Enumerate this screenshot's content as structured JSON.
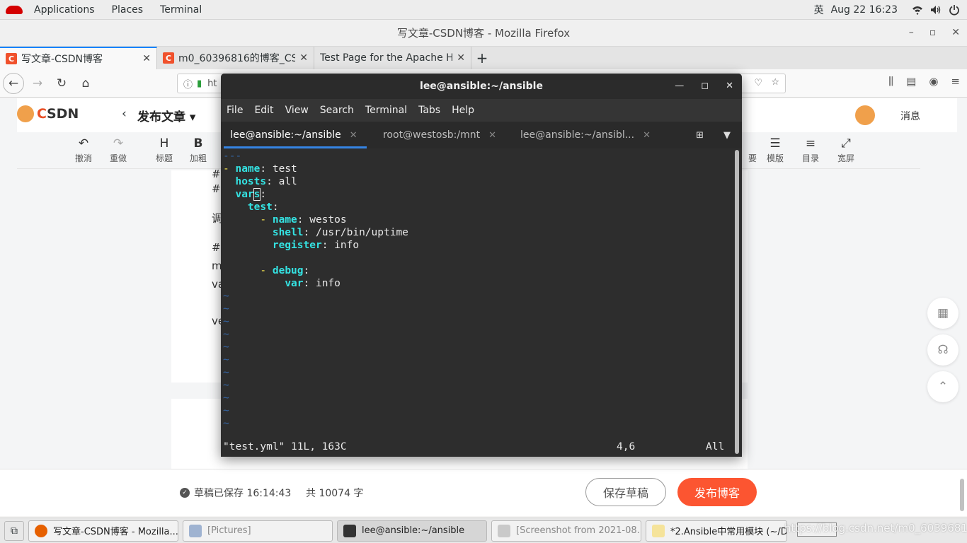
{
  "topbar": {
    "apps_label": "Applications",
    "places_label": "Places",
    "terminal_label": "Terminal",
    "input_method": "英",
    "clock": "Aug 22  16:23"
  },
  "firefox": {
    "window_title": "写文章-CSDN博客 - Mozilla Firefox",
    "tabs": [
      {
        "label": "写文章-CSDN博客",
        "active": true
      },
      {
        "label": "m0_60396816的博客_CS",
        "active": false
      },
      {
        "label": "Test Page for the Apache HT",
        "active": false
      }
    ],
    "url_fragment": "ht"
  },
  "csdn": {
    "logo_c": "C",
    "logo_rest": "SDN",
    "publish_title": "发布文章",
    "messages_label": "消息",
    "toolbar": [
      {
        "icon": "undo-icon",
        "glyph": "↶",
        "label": "撤消"
      },
      {
        "icon": "redo-icon",
        "glyph": "↷",
        "label": "重做"
      },
      {
        "icon": "heading-icon",
        "glyph": "H",
        "label": "标题"
      },
      {
        "icon": "bold-icon",
        "glyph": "B",
        "label": "加粗"
      },
      {
        "icon": "summary-icon",
        "glyph": "",
        "label": "要"
      },
      {
        "icon": "template-icon",
        "glyph": "☰",
        "label": "模版"
      },
      {
        "icon": "toc-icon",
        "glyph": "≡",
        "label": "目录"
      },
      {
        "icon": "fullwidth-icon",
        "glyph": "⤢",
        "label": "宽屏"
      }
    ],
    "editor_lines": [
      "#",
      "#",
      "调",
      "#",
      "m",
      "va",
      "ve"
    ],
    "footer": {
      "saved_text": "草稿已保存 16:14:43",
      "word_count": "共 10074 字",
      "save_draft_label": "保存草稿",
      "publish_label": "发布博客"
    }
  },
  "terminal": {
    "window_title": "lee@ansible:~/ansible",
    "menu": [
      "File",
      "Edit",
      "View",
      "Search",
      "Terminal",
      "Tabs",
      "Help"
    ],
    "tabs": [
      {
        "label": "lee@ansible:~/ansible",
        "active": true
      },
      {
        "label": "root@westosb:/mnt",
        "active": false
      },
      {
        "label": "lee@ansible:~/ansibl...",
        "active": false
      }
    ],
    "status_file": "\"test.yml\" 11L, 163C",
    "status_pos": "4,6",
    "status_all": "All"
  },
  "taskbar": {
    "items": [
      {
        "label": "写文章-CSDN博客 - Mozilla...",
        "icon": "firefox-icon"
      },
      {
        "label": "[Pictures]",
        "icon": "folder-icon"
      },
      {
        "label": "lee@ansible:~/ansible",
        "icon": "terminal-icon"
      },
      {
        "label": "[Screenshot from 2021-08...",
        "icon": "image-viewer-icon"
      },
      {
        "label": "*2.Ansible中常用模块 (~/D...",
        "icon": "text-editor-icon"
      }
    ],
    "watermark": "https://blog.csdn.net/m0_60396816"
  }
}
